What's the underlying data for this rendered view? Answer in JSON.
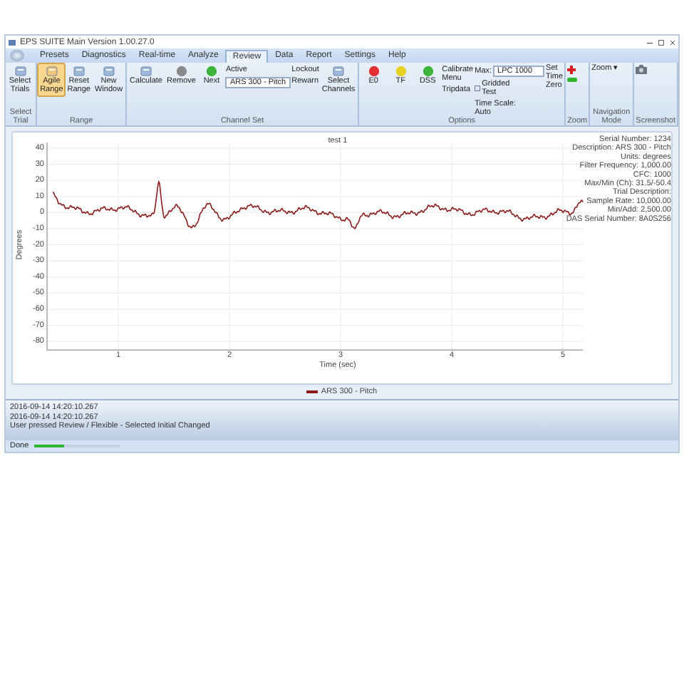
{
  "window": {
    "title": "EPS SUITE Main Version 1.00.27.0"
  },
  "tabs": [
    {
      "label": "Presets",
      "selected": false
    },
    {
      "label": "Diagnostics",
      "selected": false
    },
    {
      "label": "Real-time",
      "selected": false
    },
    {
      "label": "Analyze",
      "selected": false
    },
    {
      "label": "Review",
      "selected": true
    },
    {
      "label": "Data",
      "selected": false
    },
    {
      "label": "Report",
      "selected": false
    },
    {
      "label": "Settings",
      "selected": false
    },
    {
      "label": "Help",
      "selected": false
    }
  ],
  "ribbon_groups": [
    {
      "label": "Select Trial",
      "items": [
        {
          "kind": "large",
          "label": "Select Trials",
          "selected": false
        }
      ]
    },
    {
      "label": "Range",
      "items": [
        {
          "kind": "large",
          "label": "Agile Range",
          "selected": true
        },
        {
          "kind": "large",
          "label": "Reset Range",
          "selected": false
        },
        {
          "kind": "large",
          "label": "New Window",
          "selected": false
        }
      ]
    },
    {
      "label": "Channel Set",
      "items": [
        {
          "kind": "large",
          "label": "Calculate",
          "selected": false
        },
        {
          "kind": "ball",
          "label": "Remove",
          "color": "#8a8a8a"
        },
        {
          "kind": "ball",
          "label": "Next",
          "color": "#3cb43c"
        },
        {
          "kind": "dropdown",
          "label": "Active",
          "value": "ARS 300 - Pitch"
        },
        {
          "kind": "stack",
          "labels": [
            "Lockout",
            "Rewarn"
          ]
        },
        {
          "kind": "large",
          "label": "Select Channels",
          "selected": false
        }
      ]
    },
    {
      "label": "Options",
      "items": [
        {
          "kind": "ball",
          "label": "E0",
          "color": "#e03030"
        },
        {
          "kind": "ball",
          "label": "TF",
          "color": "#e8d020"
        },
        {
          "kind": "ball",
          "label": "DSS",
          "color": "#3cb43c"
        },
        {
          "kind": "stack",
          "labels": [
            "Calibrate Menu",
            "Tripdata"
          ]
        },
        {
          "kind": "options",
          "max_label": "Max:",
          "max_value": "LPC 1000",
          "check_label": "Gridded Test",
          "scale_label": "Time Scale: Auto"
        },
        {
          "kind": "small",
          "label": "Set Time Zero"
        }
      ]
    },
    {
      "label": "Zoom",
      "items": [
        {
          "kind": "zoom"
        }
      ]
    },
    {
      "label": "Navigation Mode",
      "items": [
        {
          "kind": "small",
          "label": "Zoom ▾"
        }
      ]
    },
    {
      "label": "Screenshot",
      "items": [
        {
          "kind": "camera"
        }
      ]
    }
  ],
  "chart": {
    "title": "test 1",
    "ylabel": "Degrees",
    "xlabel": "Time (sec)",
    "y_tick_labels": [
      "40",
      "30",
      "20",
      "10",
      "0",
      "-10",
      "-20",
      "-30",
      "-40",
      "-50",
      "-60",
      "-70",
      "-80"
    ],
    "x_tick_labels": [
      "1",
      "2",
      "3",
      "4",
      "5"
    ],
    "info": [
      "Serial Number: 1234",
      "Description: ARS 300 - Pitch",
      "Units: degrees",
      "Filter Frequency: 1,000.00",
      "CFC: 1000",
      "Max/Min (Ch): 31.5/-50.4",
      "Trial Description:",
      "Sample Rate: 10,000.00",
      "Min/Add: 2,500.00",
      "DAS Serial Number: 8A0S256"
    ],
    "legend": {
      "label": "ARS 300 - Pitch",
      "color": "#8b1a1a"
    }
  },
  "log": [
    "2016-09-14 14:20:10.267",
    "2016-09-14 14:20:10.267",
    "User pressed Review / Flexible - Selected Initial Changed"
  ],
  "status_bar": {
    "text": "Done",
    "progress": {
      "level": 0.35
    }
  }
}
